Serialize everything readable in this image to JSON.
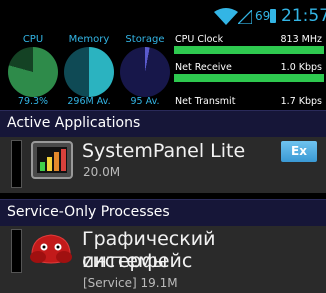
{
  "status_bar": {
    "battery_percent": "69",
    "time": "21:57",
    "icons": [
      "wifi-icon",
      "signal-icon",
      "battery-icon"
    ]
  },
  "monitor": {
    "gauges": [
      {
        "label": "CPU",
        "value": "79.3%",
        "fraction": 0.793
      },
      {
        "label": "Memory",
        "value": "296M Av.",
        "fraction": 0.5
      },
      {
        "label": "Storage",
        "value": "95 Av.",
        "fraction": 0.03
      }
    ],
    "stats": [
      {
        "label": "CPU Clock",
        "value": "813 MHz",
        "fraction": 1.0
      },
      {
        "label": "Net Receive",
        "value": "1.0 Kbps",
        "fraction": 1.0
      },
      {
        "label": "Net Transmit",
        "value": "1.7 Kbps",
        "fraction": 1.0
      }
    ]
  },
  "active_section": {
    "title": "Active Applications",
    "apps": [
      {
        "name": "SystemPanel Lite",
        "sub": "20.0M",
        "action": "Ex",
        "icon": "systempanel-icon"
      }
    ]
  },
  "service_section": {
    "title": "Service-Only Processes",
    "apps": [
      {
        "name_line1": "Графический интерфейс",
        "name_line2": "системы",
        "sub": "[Service] 19.1M",
        "icon": "android-icon"
      }
    ]
  },
  "colors": {
    "accent": "#33b5e5",
    "cpu": "#2e8b4a",
    "memory": "#2bb3c0",
    "storage": "#5a5acd",
    "stat_bar": "#2ec94f",
    "section_header": "#161638"
  }
}
